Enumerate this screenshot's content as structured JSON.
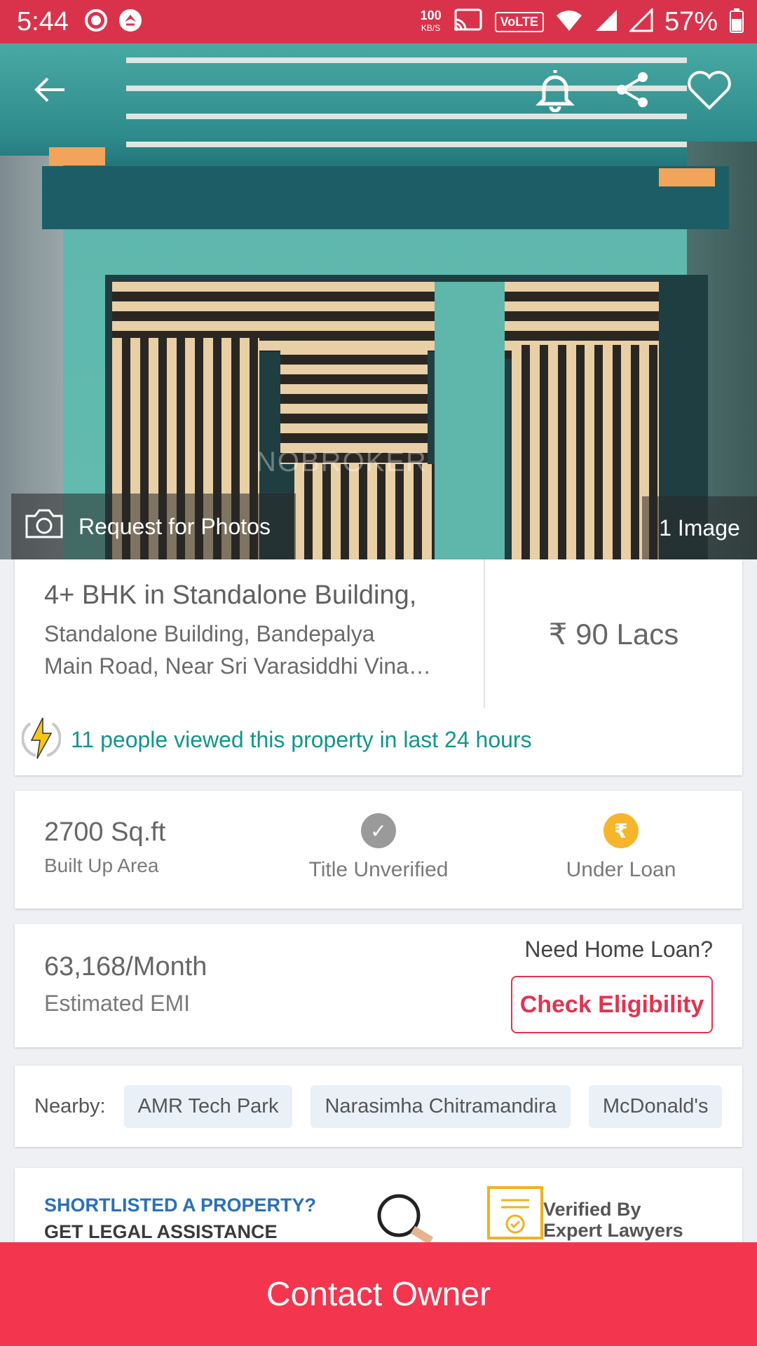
{
  "status_bar": {
    "time": "5:44",
    "net_speed": "100",
    "net_unit": "KB/S",
    "volte": "VoLTE",
    "battery": "57%"
  },
  "hero": {
    "request_photos_label": "Request for Photos",
    "image_count": "1 Image",
    "watermark": "NOBROKER"
  },
  "property": {
    "title": "4+ BHK in Standalone Building,",
    "address_line1": "Standalone Building, Bandepalya",
    "address_line2": "Main Road, Near Sri Varasiddhi Vina…",
    "price": "₹ 90 Lacs",
    "views_text": "11 people viewed this property in last 24 hours"
  },
  "stats": {
    "area_value": "2700 Sq.ft",
    "area_label": "Built Up Area",
    "title_icon": "✓",
    "title_label": "Title Unverified",
    "loan_icon": "₹",
    "loan_label": "Under Loan"
  },
  "emi": {
    "value": "63,168/Month",
    "label": "Estimated EMI",
    "need_loan": "Need Home Loan?",
    "button": "Check Eligibility"
  },
  "nearby": {
    "label": "Nearby:",
    "places": [
      "AMR Tech Park",
      "Narasimha Chitramandira",
      "McDonald's"
    ]
  },
  "legal": {
    "line1": "SHORTLISTED A PROPERTY?",
    "line2": "GET LEGAL ASSISTANCE",
    "verified_line1": "Verified By",
    "verified_line2": "Expert Lawyers"
  },
  "cta": {
    "contact": "Contact Owner"
  },
  "colors": {
    "status_bar": "#d9334b",
    "accent": "#e23350",
    "cta": "#f3354e",
    "views_green": "#12958a",
    "loan_badge": "#f7b52c",
    "verify_badge": "#9a9a9a",
    "legal_blue": "#2c6fb7"
  },
  "icons": {
    "back": "back-arrow-icon",
    "bell": "bell-icon",
    "share": "share-icon",
    "heart": "heart-icon",
    "camera": "camera-icon",
    "lightning": "lightning-icon",
    "magnifier": "magnifier-icon",
    "certificate": "certificate-icon"
  }
}
